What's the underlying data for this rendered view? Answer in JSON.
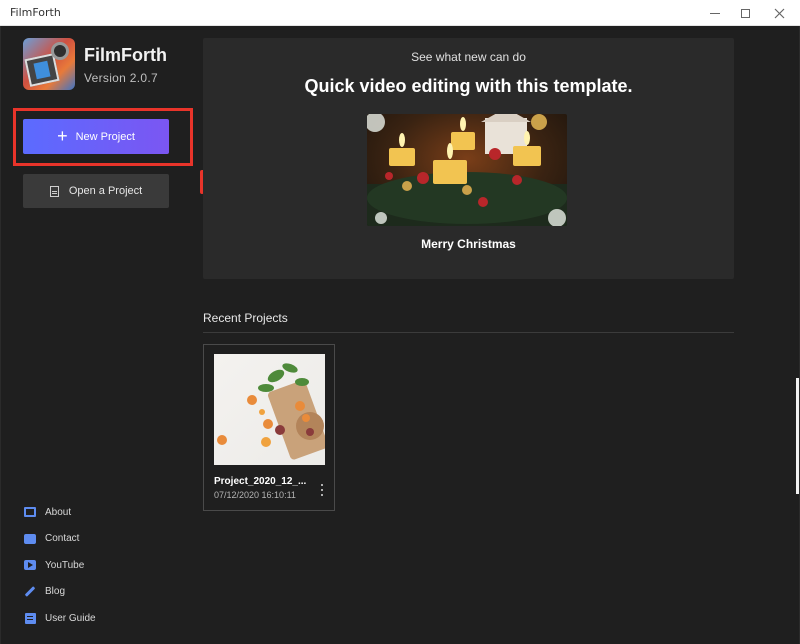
{
  "window": {
    "title": "FilmForth"
  },
  "app": {
    "name": "FilmForth",
    "version": "Version  2.0.7"
  },
  "actions": {
    "new_project": "New Project",
    "open_project": "Open a Project"
  },
  "banner": {
    "subtitle": "See what new can do",
    "title": "Quick video editing with this template.",
    "caption": "Merry Christmas"
  },
  "recent": {
    "heading": "Recent Projects",
    "projects": [
      {
        "name": "Project_2020_12_...",
        "date": "07/12/2020 16:10:11"
      }
    ]
  },
  "links": [
    {
      "label": "About",
      "icon": "book-icon"
    },
    {
      "label": "Contact",
      "icon": "contact-icon"
    },
    {
      "label": "YouTube",
      "icon": "youtube-icon"
    },
    {
      "label": "Blog",
      "icon": "pen-icon"
    },
    {
      "label": "User Guide",
      "icon": "guide-icon"
    }
  ],
  "colors": {
    "accent_start": "#5b6bff",
    "accent_end": "#7b56f2",
    "highlight": "#e8342a",
    "link_icon": "#5e8cf0"
  }
}
